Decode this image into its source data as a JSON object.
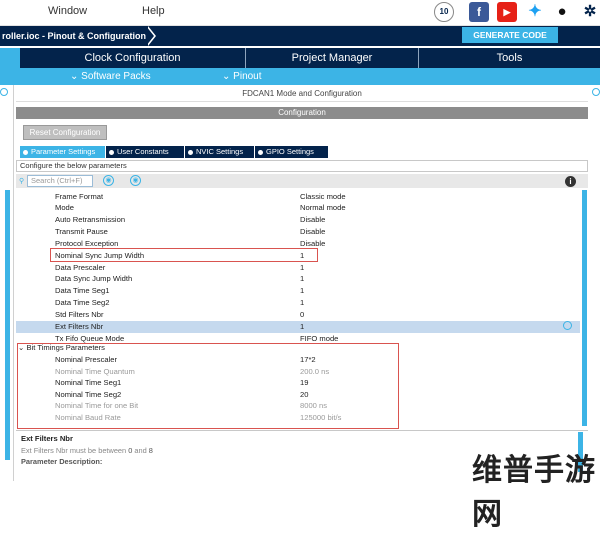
{
  "menu": {
    "window": "Window",
    "help": "Help"
  },
  "social_icons": [
    "st-10-badge-icon",
    "facebook-icon",
    "youtube-icon",
    "twitter-icon",
    "github-icon",
    "network-icon"
  ],
  "breadcrumb": "roller.ioc - Pinout & Configuration",
  "generate_code": "GENERATE CODE",
  "tabs": [
    "Clock Configuration",
    "Project Manager",
    "Tools"
  ],
  "subtabs": [
    "Software Packs",
    "Pinout"
  ],
  "mode_header": "FDCAN1 Mode and Configuration",
  "configuration_header": "Configuration",
  "reset_button": "Reset Configuration",
  "param_tabs": [
    "Parameter Settings",
    "User Constants",
    "NVIC Settings",
    "GPIO Settings"
  ],
  "configure_label": "Configure the below parameters",
  "search_placeholder": "Search (Ctrl+F)",
  "parameters": [
    {
      "label": "Frame Format",
      "value": "Classic mode"
    },
    {
      "label": "Mode",
      "value": "Normal mode"
    },
    {
      "label": "Auto Retransmission",
      "value": "Disable"
    },
    {
      "label": "Transmit Pause",
      "value": "Disable"
    },
    {
      "label": "Protocol Exception",
      "value": "Disable"
    },
    {
      "label": "Nominal Sync Jump Width",
      "value": "1"
    },
    {
      "label": "Data Prescaler",
      "value": "1"
    },
    {
      "label": "Data Sync Jump Width",
      "value": "1"
    },
    {
      "label": "Data Time Seg1",
      "value": "1"
    },
    {
      "label": "Data Time Seg2",
      "value": "1"
    },
    {
      "label": "Std Filters Nbr",
      "value": "0"
    },
    {
      "label": "Ext Filters Nbr",
      "value": "1"
    },
    {
      "label": "Tx Fifo Queue Mode",
      "value": "FIFO mode"
    }
  ],
  "bit_timings_group": "Bit Timings Parameters",
  "bit_timings": [
    {
      "label": "Nominal Prescaler",
      "value": "17*2",
      "grey": false
    },
    {
      "label": "Nominal Time Quantum",
      "value": "200.0 ns",
      "grey": true
    },
    {
      "label": "Nominal Time Seg1",
      "value": "19",
      "grey": false
    },
    {
      "label": "Nominal Time Seg2",
      "value": "20",
      "grey": false
    },
    {
      "label": "Nominal Time for one Bit",
      "value": "8000 ns",
      "grey": true
    },
    {
      "label": "Nominal Baud Rate",
      "value": "125000 bit/s",
      "grey": true
    }
  ],
  "description": {
    "title": "Ext Filters Nbr",
    "text_prefix": "Ext Filters Nbr must be between ",
    "min": "0",
    "and": " and ",
    "max": "8",
    "label": "Parameter Description:"
  },
  "watermark": "维普手游网",
  "colors": {
    "navy": "#03234b",
    "accent": "#3cb4e6",
    "highlight": "#d9534f"
  }
}
